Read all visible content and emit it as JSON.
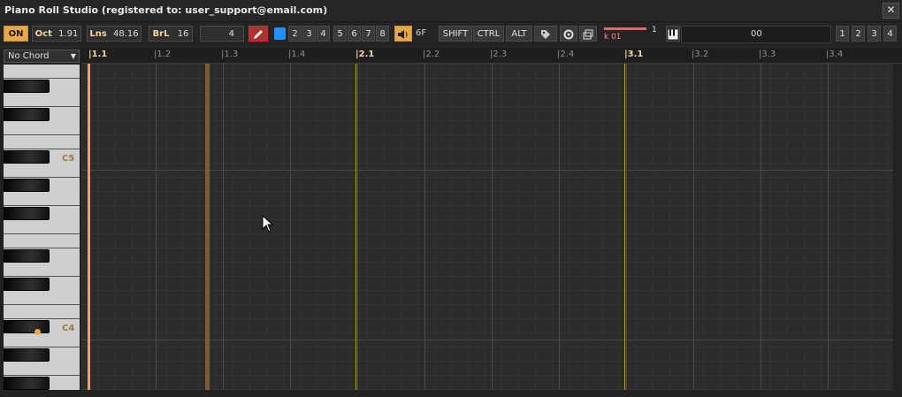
{
  "window": {
    "title": "Piano Roll Studio  (registered to: user_support@email.com)",
    "close_icon": "close-icon"
  },
  "toolbar": {
    "on_label": "ON",
    "oct_label": "Oct",
    "oct_value": "1.91",
    "lns_label": "Lns",
    "lns_value": "48.16",
    "brl_label": "BrL",
    "brl_value": "16",
    "grid_value": "4",
    "channel_buttons": [
      "2",
      "3",
      "4"
    ],
    "group_buttons": [
      "5",
      "6",
      "7",
      "8"
    ],
    "sound_label": "6F",
    "shift_label": "SHIFT",
    "ctrl_label": "CTRL",
    "alt_label": "ALT",
    "velocity_value": "1",
    "velocity_label": "k 01",
    "field_value": "00",
    "page_buttons": [
      "1",
      "2",
      "3",
      "4"
    ]
  },
  "chord": {
    "label": "No Chord"
  },
  "keyboard": {
    "labels": [
      "C5",
      "C4"
    ]
  },
  "ruler": {
    "ticks": [
      "1.1",
      "1.2",
      "1.3",
      "1.4",
      "2.1",
      "2.2",
      "2.3",
      "2.4",
      "3.1",
      "3.2",
      "3.3",
      "3.4"
    ]
  },
  "colors": {
    "accent": "#e8a84a",
    "grid_bg": "#2c2c2c",
    "bar_line": "#c8924a",
    "pencil": "#b03030",
    "color_swatch": "#1e90ff"
  }
}
